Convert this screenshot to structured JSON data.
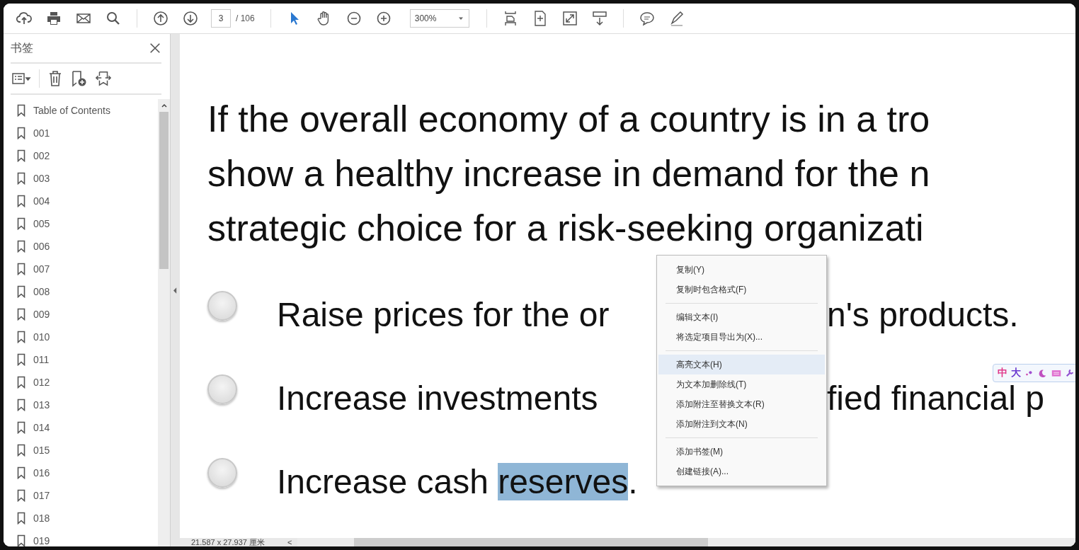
{
  "toolbar": {
    "page_field": "3",
    "page_total": "/ 106",
    "zoom": "300%"
  },
  "bookmarks_panel": {
    "title": "书签",
    "items": [
      {
        "label": "Table of Contents"
      },
      {
        "label": "001"
      },
      {
        "label": "002"
      },
      {
        "label": "003"
      },
      {
        "label": "004"
      },
      {
        "label": "005"
      },
      {
        "label": "006"
      },
      {
        "label": "007"
      },
      {
        "label": "008"
      },
      {
        "label": "009"
      },
      {
        "label": "010"
      },
      {
        "label": "011"
      },
      {
        "label": "012"
      },
      {
        "label": "013"
      },
      {
        "label": "014"
      },
      {
        "label": "015"
      },
      {
        "label": "016"
      },
      {
        "label": "017"
      },
      {
        "label": "018"
      },
      {
        "label": "019"
      }
    ]
  },
  "document": {
    "question": [
      "If the overall economy of a country is in a tro",
      "show a healthy increase in demand for the n",
      "strategic choice for a risk-seeking organizati"
    ],
    "options": [
      {
        "selected": false,
        "segments": [
          {
            "text": "Raise prices for the or",
            "highlighted": false
          }
        ],
        "after_menu": "n's products."
      },
      {
        "selected": false,
        "segments": [
          {
            "text": "Increase investments",
            "highlighted": false
          }
        ],
        "after_menu": "fied financial p"
      },
      {
        "selected": false,
        "segments": [
          {
            "text": "Increase cash ",
            "highlighted": false
          },
          {
            "text": "reserves",
            "highlighted": true
          },
          {
            "text": ".",
            "highlighted": false
          }
        ]
      }
    ]
  },
  "context_menu": {
    "groups": [
      [
        {
          "label": "复制(Y)",
          "selected": false
        },
        {
          "label": "复制时包含格式(F)",
          "selected": false
        }
      ],
      [
        {
          "label": "编辑文本(I)",
          "selected": false
        },
        {
          "label": "将选定项目导出为(X)...",
          "selected": false
        }
      ],
      [
        {
          "label": "高亮文本(H)",
          "selected": true
        },
        {
          "label": "为文本加删除线(T)",
          "selected": false
        },
        {
          "label": "添加附注至替换文本(R)",
          "selected": false
        },
        {
          "label": "添加附注到文本(N)",
          "selected": false
        }
      ],
      [
        {
          "label": "添加书签(M)",
          "selected": false
        },
        {
          "label": "创建链接(A)...",
          "selected": false
        }
      ]
    ]
  },
  "ime_toolbar": {
    "chars": [
      "中",
      "大"
    ]
  },
  "status_bar": {
    "page_size": "21.587 x 27.937 厘米",
    "scroll_left": "<"
  }
}
